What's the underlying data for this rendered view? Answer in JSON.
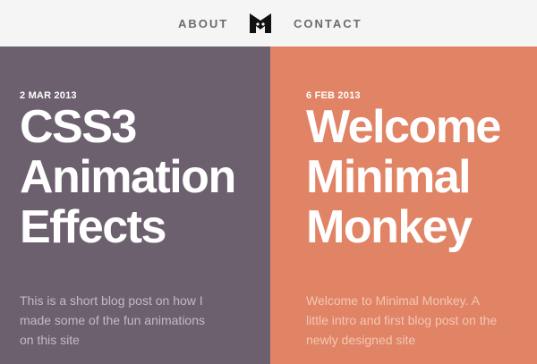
{
  "nav": {
    "about_label": "ABOUT",
    "contact_label": "CONTACT",
    "logo_icon": "monkey-logo-icon"
  },
  "colors": {
    "nav_bg": "#f5f5f5",
    "nav_text": "#6b6b6b",
    "card_left_bg": "#6c606f",
    "card_right_bg": "#e08465"
  },
  "posts": [
    {
      "date": "2 MAR 2013",
      "title_lines": [
        "CSS3",
        "Animation",
        "Effects"
      ],
      "excerpt_lines": [
        "This is a short blog post on how I",
        "made some of the fun animations",
        "on this site"
      ]
    },
    {
      "date": "6 FEB 2013",
      "title_lines": [
        "Welcome",
        "Minimal",
        "Monkey"
      ],
      "excerpt_lines": [
        "Welcome to Minimal Monkey. A",
        "little intro and first blog post on the",
        "newly designed site"
      ]
    }
  ]
}
